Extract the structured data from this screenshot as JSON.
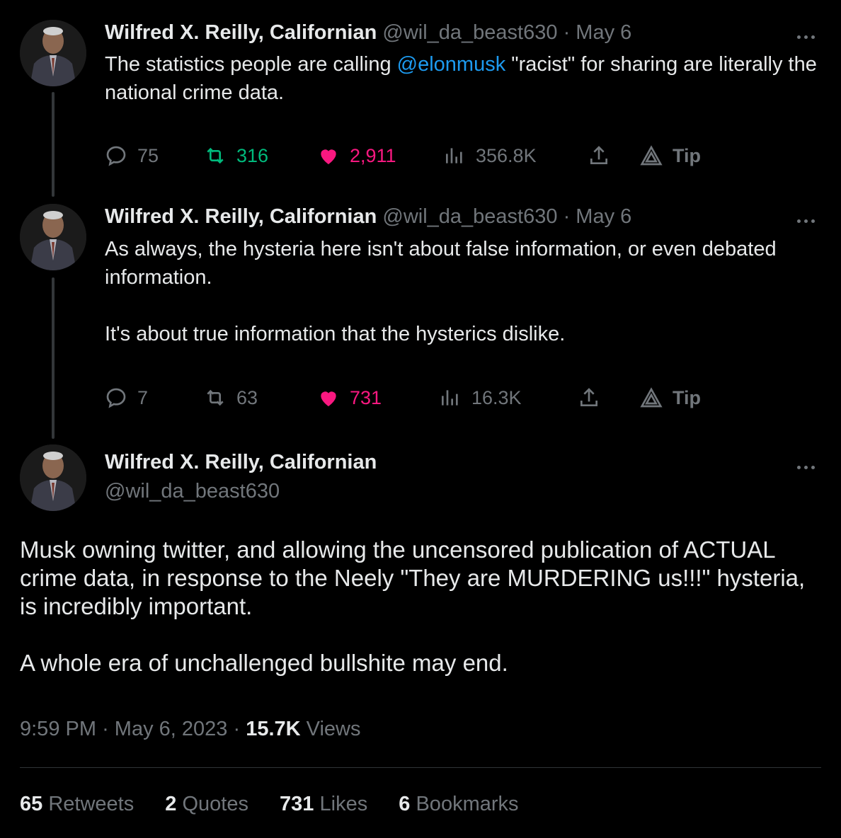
{
  "tweets": [
    {
      "name": "Wilfred X. Reilly, Californian",
      "handle": "@wil_da_beast630",
      "sep": "·",
      "date": "May 6",
      "text_before": "The statistics people are calling ",
      "mention": "@elonmusk",
      "text_after": " \"racist\" for sharing are literally the national crime data.",
      "replies": "75",
      "retweets": "316",
      "likes": "2,911",
      "views": "356.8K",
      "tip": "Tip"
    },
    {
      "name": "Wilfred X. Reilly, Californian",
      "handle": "@wil_da_beast630",
      "sep": "·",
      "date": "May 6",
      "text_p1": "As always, the hysteria here isn't about false information, or even debated information.",
      "text_p2": "It's about true information that the hysterics dislike.",
      "replies": "7",
      "retweets": "63",
      "likes": "731",
      "views": "16.3K",
      "tip": "Tip"
    }
  ],
  "main": {
    "name": "Wilfred X. Reilly, Californian",
    "handle": "@wil_da_beast630",
    "text_p1": "Musk owning twitter, and allowing the uncensored publication of ACTUAL crime data, in response to the Neely \"They are MURDERING us!!!\" hysteria, is incredibly important.",
    "text_p2": "A whole era of unchallenged bullshite may end.",
    "time": "9:59 PM",
    "sep": "·",
    "date": "May 6, 2023",
    "views_count": "15.7K",
    "views_label": "Views",
    "stats": {
      "retweets_count": "65",
      "retweets_label": "Retweets",
      "quotes_count": "2",
      "quotes_label": "Quotes",
      "likes_count": "731",
      "likes_label": "Likes",
      "bookmarks_count": "6",
      "bookmarks_label": "Bookmarks"
    }
  },
  "colors": {
    "background": "#000000",
    "text": "#e7e9ea",
    "muted": "#71767b",
    "link": "#1d9bf0",
    "retweet": "#00ba7c",
    "like": "#f91880"
  },
  "icons": [
    "reply-icon",
    "retweet-icon",
    "heart-icon",
    "views-icon",
    "share-icon",
    "tip-icon",
    "more-icon"
  ]
}
